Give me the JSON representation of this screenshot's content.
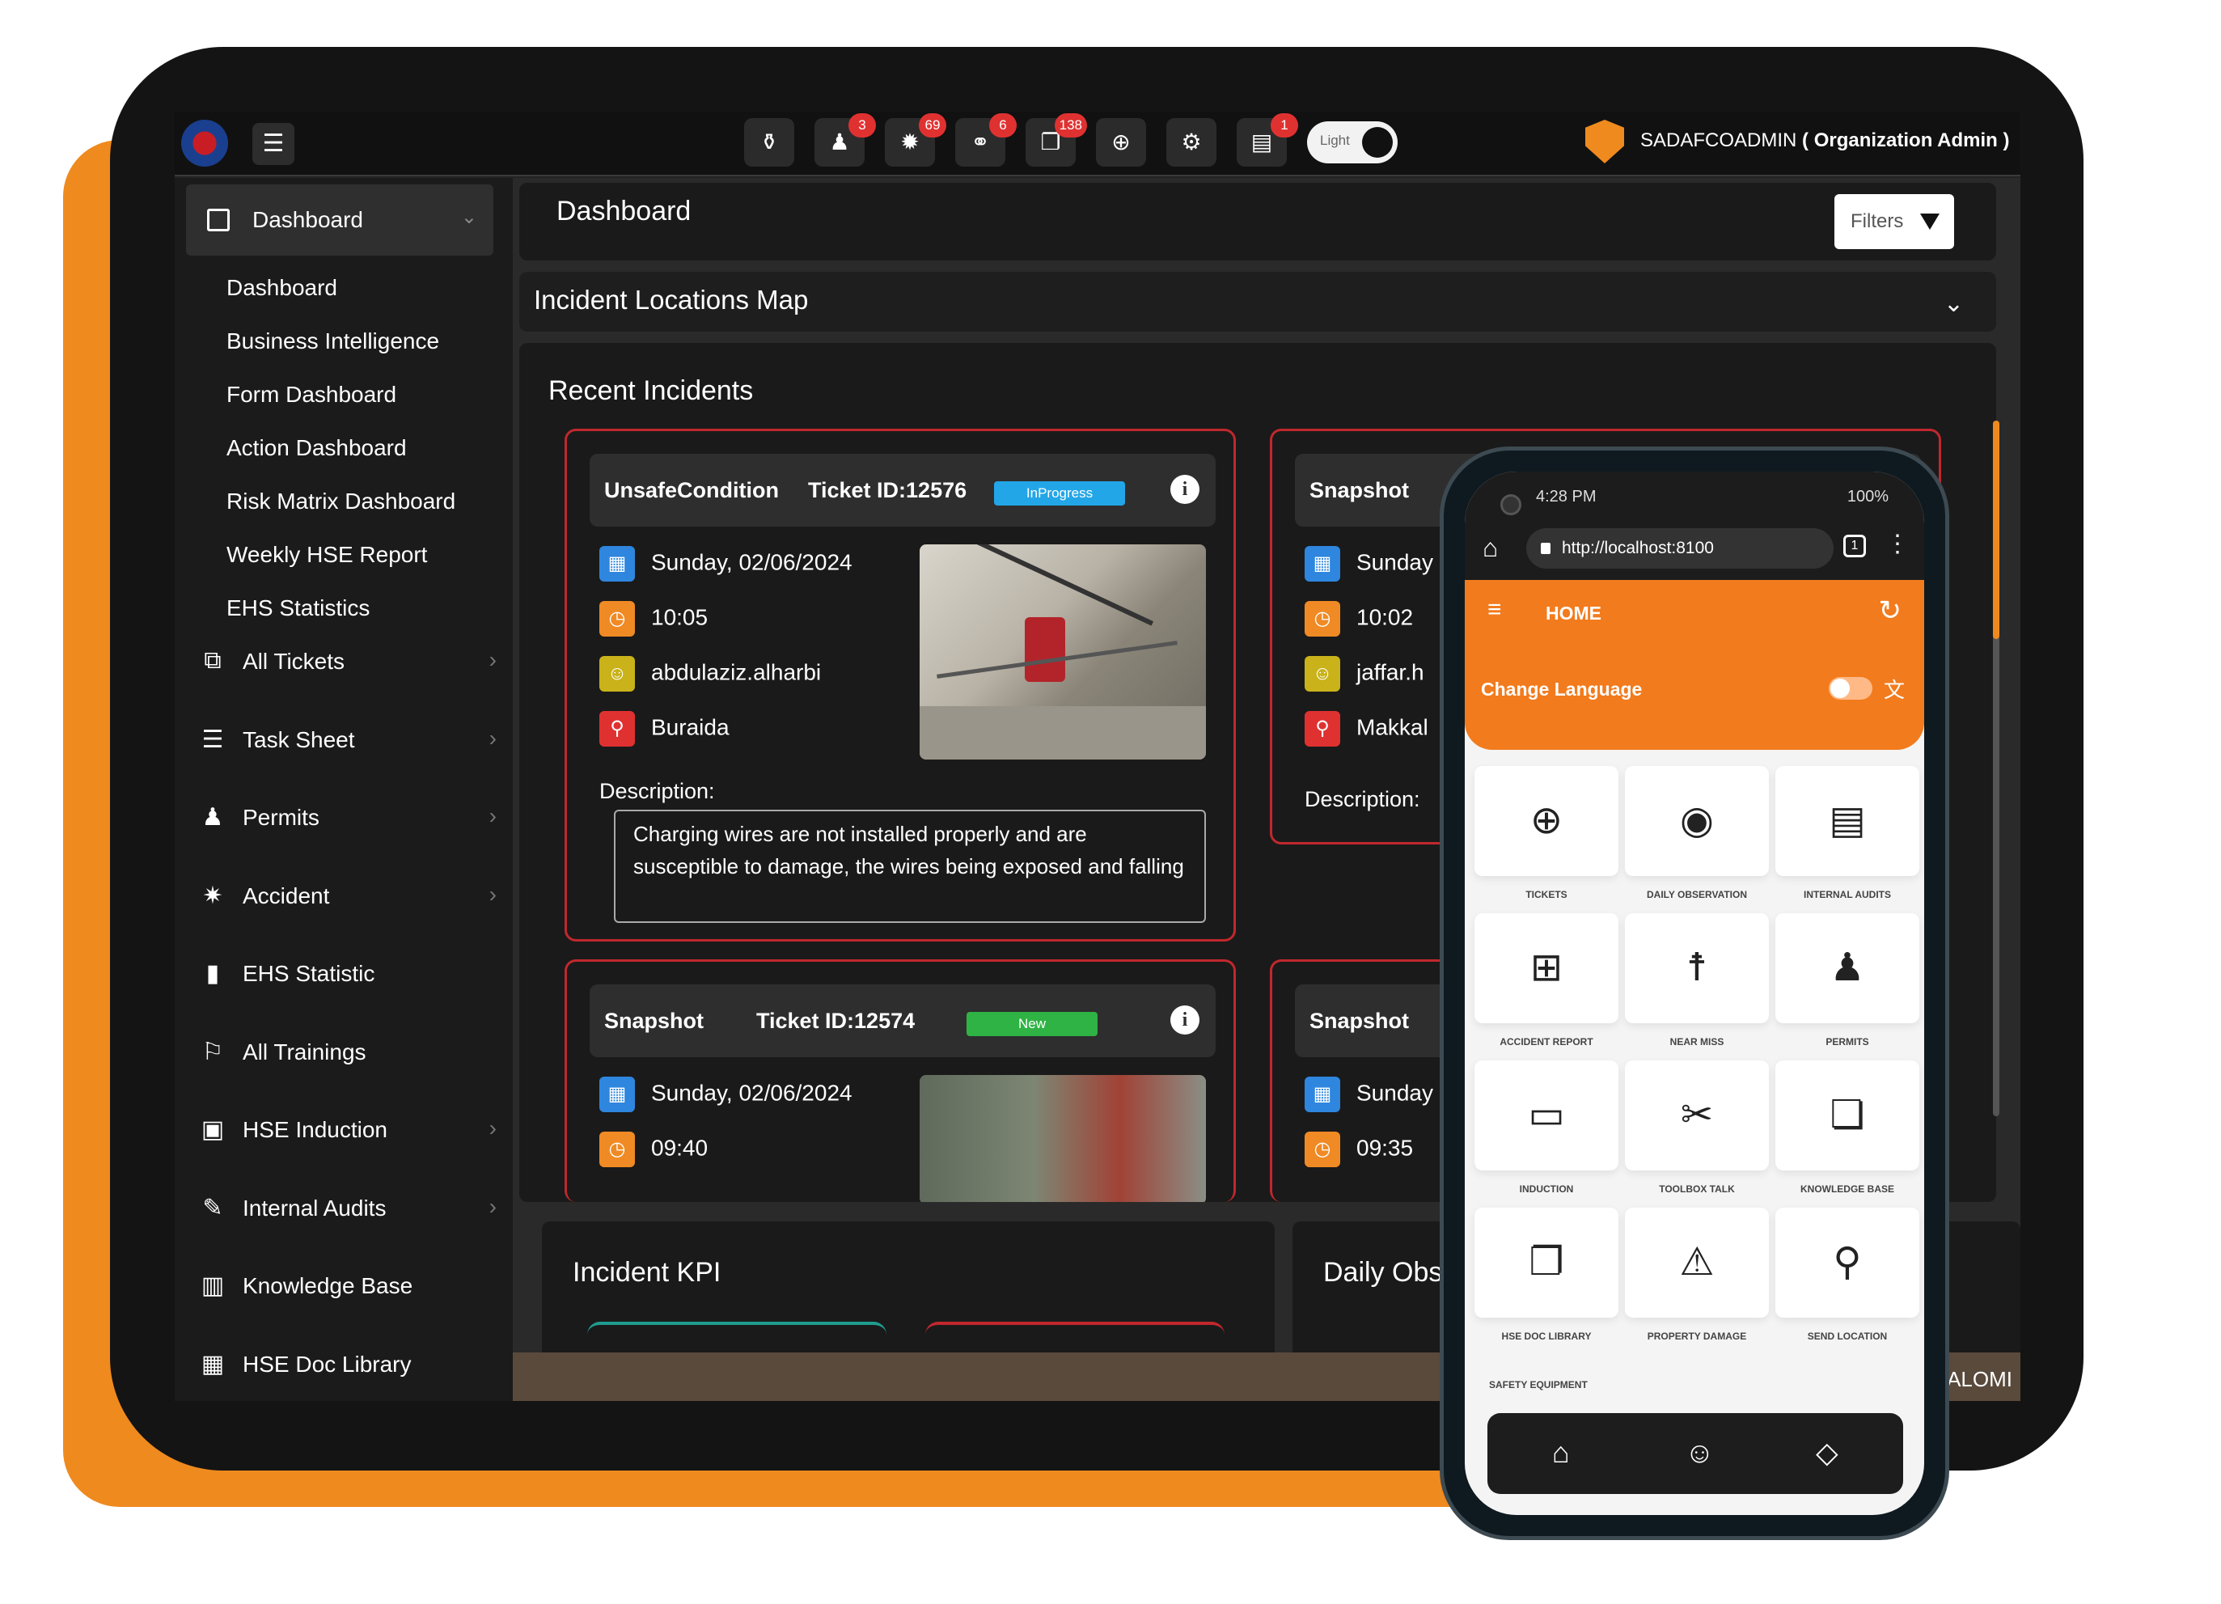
{
  "topbar": {
    "icons": [
      {
        "name": "flame-icon",
        "glyph": "⚱",
        "badge": ""
      },
      {
        "name": "worker-icon",
        "glyph": "♟",
        "badge": "3"
      },
      {
        "name": "virus-icon",
        "glyph": "✹",
        "badge": "69"
      },
      {
        "name": "handshake-icon",
        "glyph": "⚭",
        "badge": "6"
      },
      {
        "name": "tickets-icon",
        "glyph": "❐",
        "badge": "138"
      },
      {
        "name": "lifebuoy-icon",
        "glyph": "⊕",
        "badge": ""
      },
      {
        "name": "settings-icon",
        "glyph": "⚙",
        "badge": ""
      },
      {
        "name": "document-icon",
        "glyph": "▤",
        "badge": "1"
      }
    ],
    "theme_label": "Light",
    "user": "SADAFCOADMIN",
    "role": "( Organization Admin )"
  },
  "sidebar": {
    "dashboard_label": "Dashboard",
    "sub_items": [
      "Dashboard",
      "Business Intelligence",
      "Form Dashboard",
      "Action Dashboard",
      "Risk Matrix Dashboard",
      "Weekly HSE Report",
      "EHS Statistics"
    ],
    "items": [
      {
        "label": "All Tickets",
        "icon": "⧉",
        "chevron": true
      },
      {
        "label": "Task Sheet",
        "icon": "☰",
        "chevron": true
      },
      {
        "label": "Permits",
        "icon": "♟",
        "chevron": true
      },
      {
        "label": "Accident",
        "icon": "✷",
        "chevron": true
      },
      {
        "label": "EHS Statistic",
        "icon": "▮",
        "chevron": false
      },
      {
        "label": "All Trainings",
        "icon": "⚐",
        "chevron": false
      },
      {
        "label": "HSE Induction",
        "icon": "▣",
        "chevron": true
      },
      {
        "label": "Internal Audits",
        "icon": "✎",
        "chevron": true
      },
      {
        "label": "Knowledge Base",
        "icon": "▥",
        "chevron": false
      },
      {
        "label": "HSE Doc Library",
        "icon": "▦",
        "chevron": false
      }
    ]
  },
  "main": {
    "title": "Dashboard",
    "filters_label": "Filters",
    "map_title": "Incident Locations Map",
    "recent_title": "Recent Incidents",
    "description_label": "Description:",
    "incidents": [
      {
        "type": "UnsafeCondition",
        "ticket": "Ticket ID:12576",
        "status": "InProgress",
        "status_color": "#22a6e8",
        "date": "Sunday, 02/06/2024",
        "time": "10:05",
        "user": "abdulaziz.alharbi",
        "location": "Buraida",
        "description": "Charging wires are not installed properly and are susceptible to damage, the wires being exposed and falling"
      },
      {
        "type": "Snapshot",
        "date": "Sunday",
        "time": "10:02",
        "user": "jaffar.h",
        "location": "Makkal"
      },
      {
        "type": "Snapshot",
        "ticket": "Ticket ID:12574",
        "status": "New",
        "status_color": "#2fb344",
        "date": "Sunday, 02/06/2024",
        "time": "09:40"
      },
      {
        "type": "Snapshot",
        "date": "Sunday",
        "time": "09:35"
      }
    ],
    "kpi_title": "Incident KPI",
    "daily_title": "Daily Obs",
    "footer_text": "SALOMI"
  },
  "phone": {
    "time": "4:28 PM",
    "battery": "100%",
    "url": "http://localhost:8100",
    "tabs_count": "1",
    "header_title": "HOME",
    "change_language": "Change Language",
    "tiles": [
      {
        "label": "TICKETS",
        "icon": "⊕"
      },
      {
        "label": "DAILY OBSERVATION",
        "icon": "◉"
      },
      {
        "label": "INTERNAL AUDITS",
        "icon": "▤"
      },
      {
        "label": "ACCIDENT REPORT",
        "icon": "⊞"
      },
      {
        "label": "NEAR MISS",
        "icon": "☨"
      },
      {
        "label": "PERMITS",
        "icon": "♟"
      },
      {
        "label": "INDUCTION",
        "icon": "▭"
      },
      {
        "label": "TOOLBOX TALK",
        "icon": "✂"
      },
      {
        "label": "KNOWLEDGE BASE",
        "icon": "❏"
      },
      {
        "label": "HSE DOC LIBRARY",
        "icon": "❐"
      },
      {
        "label": "PROPERTY DAMAGE",
        "icon": "⚠"
      },
      {
        "label": "SEND LOCATION",
        "icon": "⚲"
      }
    ],
    "safety_label": "SAFETY EQUIPMENT",
    "nav": [
      {
        "name": "home-icon",
        "glyph": "⌂"
      },
      {
        "name": "user-icon",
        "glyph": "☺"
      },
      {
        "name": "tag-icon",
        "glyph": "◇"
      }
    ]
  }
}
